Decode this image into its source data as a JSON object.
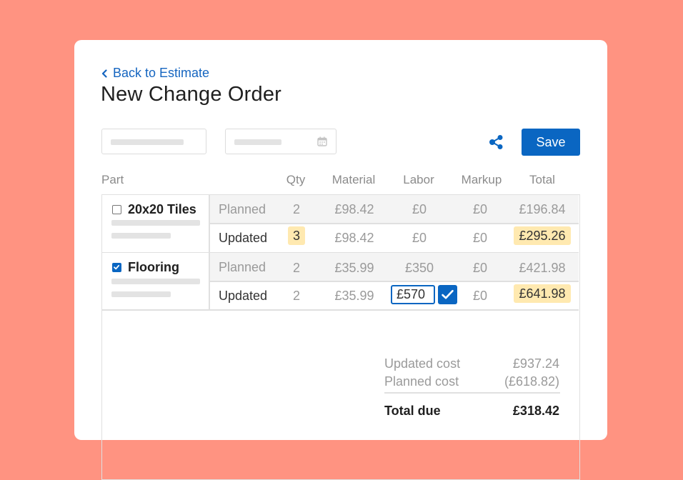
{
  "header": {
    "back_label": "Back to Estimate",
    "title": "New Change Order",
    "save_label": "Save"
  },
  "icons": {
    "back": "chevron-left-icon",
    "calendar": "calendar-icon",
    "share": "share-icon",
    "checkbox": "checkbox-icon",
    "confirm": "checkmark-icon"
  },
  "colors": {
    "background": "#FF9381",
    "accent": "#0A66C2",
    "highlight": "#FFE9B0"
  },
  "columns": {
    "part": "Part",
    "qty": "Qty",
    "material": "Material",
    "labor": "Labor",
    "markup": "Markup",
    "total": "Total"
  },
  "parts": [
    {
      "name": "20x20 Tiles",
      "checked": false,
      "planned": {
        "label": "Planned",
        "qty": "2",
        "material": "£98.42",
        "labor": "£0",
        "markup": "£0",
        "total": "£196.84"
      },
      "updated": {
        "label": "Updated",
        "qty": "3",
        "material": "£98.42",
        "labor": "£0",
        "markup": "£0",
        "total": "£295.26"
      }
    },
    {
      "name": "Flooring",
      "checked": true,
      "planned": {
        "label": "Planned",
        "qty": "2",
        "material": "£35.99",
        "labor": "£350",
        "markup": "£0",
        "total": "£421.98"
      },
      "updated": {
        "label": "Updated",
        "qty": "2",
        "material": "£35.99",
        "labor": "£570",
        "markup": "£0",
        "total": "£641.98"
      }
    }
  ],
  "summary": {
    "updated_cost_label": "Updated cost",
    "updated_cost": "£937.24",
    "planned_cost_label": "Planned cost",
    "planned_cost": "(£618.82)",
    "total_due_label": "Total due",
    "total_due": "£318.42"
  }
}
